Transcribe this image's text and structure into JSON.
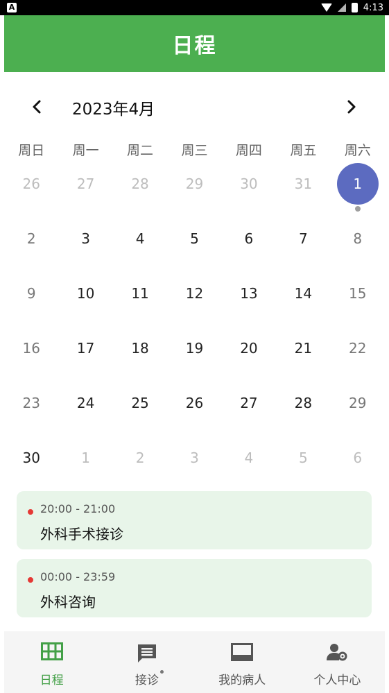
{
  "status_bar": {
    "time": "4:13"
  },
  "app_bar": {
    "title": "日程"
  },
  "calendar": {
    "month_label": "2023年4月",
    "weekdays": [
      "周日",
      "周一",
      "周二",
      "周三",
      "周四",
      "周五",
      "周六"
    ],
    "weeks": [
      [
        "26",
        "27",
        "28",
        "29",
        "30",
        "31",
        "1"
      ],
      [
        "2",
        "3",
        "4",
        "5",
        "6",
        "7",
        "8"
      ],
      [
        "9",
        "10",
        "11",
        "12",
        "13",
        "14",
        "15"
      ],
      [
        "16",
        "17",
        "18",
        "19",
        "20",
        "21",
        "22"
      ],
      [
        "23",
        "24",
        "25",
        "26",
        "27",
        "28",
        "29"
      ],
      [
        "30",
        "1",
        "2",
        "3",
        "4",
        "5",
        "6"
      ]
    ],
    "selected_day": "1"
  },
  "events": [
    {
      "time": "20:00 - 21:00",
      "title": "外科手术接诊"
    },
    {
      "time": "00:00 - 23:59",
      "title": "外科咨询"
    }
  ],
  "tabs": [
    {
      "label": "日程",
      "icon": "calendar-grid-icon",
      "active": true
    },
    {
      "label": "接诊",
      "icon": "message-icon",
      "active": false
    },
    {
      "label": "我的病人",
      "icon": "patients-icon",
      "active": false
    },
    {
      "label": "个人中心",
      "icon": "user-settings-icon",
      "active": false
    }
  ],
  "colors": {
    "primary": "#4caf50",
    "selected": "#5c6bc0",
    "event_bg": "#e8f5e9",
    "event_dot": "#e53935"
  }
}
